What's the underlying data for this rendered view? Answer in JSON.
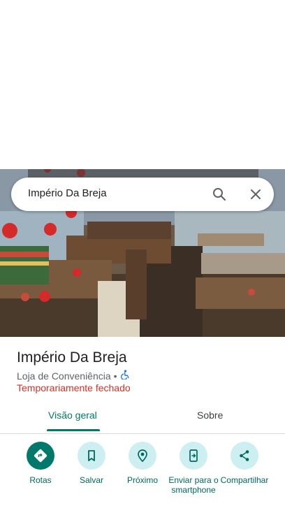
{
  "search": {
    "query": "Império Da Breja"
  },
  "place": {
    "name": "Império Da Breja",
    "category": "Loja de Conveniência",
    "separator": "•",
    "status": "Temporariamente fechado"
  },
  "tabs": [
    {
      "label": "Visão geral",
      "active": true
    },
    {
      "label": "Sobre",
      "active": false
    }
  ],
  "actions": [
    {
      "label": "Rotas",
      "icon": "directions-icon"
    },
    {
      "label": "Salvar",
      "icon": "bookmark-icon"
    },
    {
      "label": "Próximo",
      "icon": "nearby-icon"
    },
    {
      "label": "Enviar para o smartphone",
      "icon": "send-to-phone-icon"
    },
    {
      "label": "Compartilhar",
      "icon": "share-icon"
    }
  ],
  "colors": {
    "accent": "#00796b",
    "status_closed": "#d93025",
    "action_bg": "#cdeff2"
  }
}
